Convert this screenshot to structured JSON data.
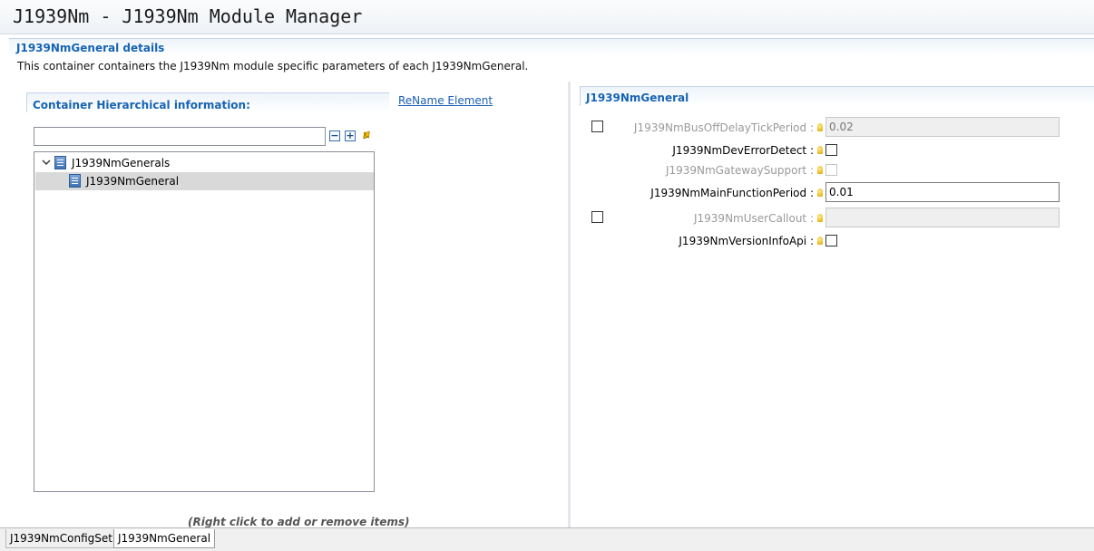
{
  "window": {
    "title": "J1939Nm - J1939Nm Module Manager"
  },
  "details": {
    "header": "J1939NmGeneral details",
    "description": "This container containers the J1939Nm module specific parameters of each J1939NmGeneral."
  },
  "left": {
    "group_title": "Container Hierarchical information:",
    "rename_link": "ReName Element",
    "filter_value": "",
    "collapse_icon": "collapse-all-icon",
    "expand_icon": "expand-all-icon",
    "sync_icon": "sync-icon",
    "tree": {
      "root": {
        "label": "J1939NmGenerals",
        "expanded": true
      },
      "child": {
        "label": "J1939NmGeneral",
        "selected": true
      }
    },
    "hint": "(Right click to add or remove items)"
  },
  "right": {
    "title": "J1939NmGeneral",
    "properties": [
      {
        "label": "J1939NmBusOffDelayTickPeriod :",
        "type": "text",
        "value": "0.02",
        "enabled": false,
        "optional": true
      },
      {
        "label": "J1939NmDevErrorDetect :",
        "type": "checkbox",
        "checked": false,
        "enabled": true
      },
      {
        "label": "J1939NmGatewaySupport :",
        "type": "checkbox",
        "checked": false,
        "enabled": false
      },
      {
        "label": "J1939NmMainFunctionPeriod :",
        "type": "text",
        "value": "0.01",
        "enabled": true
      },
      {
        "label": "J1939NmUserCallout :",
        "type": "text",
        "value": "",
        "enabled": false,
        "optional": true
      },
      {
        "label": "J1939NmVersionInfoApi :",
        "type": "checkbox",
        "checked": false,
        "enabled": true
      }
    ]
  },
  "tabs": [
    {
      "label": "J1939NmConfigSet",
      "active": false
    },
    {
      "label": "J1939NmGeneral",
      "active": true
    }
  ]
}
